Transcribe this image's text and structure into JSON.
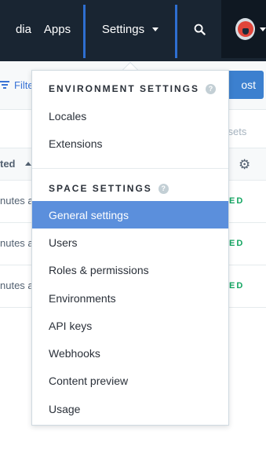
{
  "topnav": {
    "media_label": "dia",
    "apps_label": "Apps",
    "settings_label": "Settings",
    "search_icon": "search-icon",
    "account_icon": "avatar"
  },
  "toolbar": {
    "filter_label": "Filte",
    "add_button_label": "ost"
  },
  "assets_link": "ssets",
  "table": {
    "updated_header": "ted",
    "rows": [
      {
        "time": "nutes ag",
        "status": "ED"
      },
      {
        "time": "nutes a",
        "status": "ED"
      },
      {
        "time": "nutes a",
        "status": "ED"
      }
    ]
  },
  "dropdown": {
    "environment_heading": "ENVIRONMENT SETTINGS",
    "environment_items": [
      "Locales",
      "Extensions"
    ],
    "space_heading": "SPACE SETTINGS",
    "space_items": [
      "General settings",
      "Users",
      "Roles & permissions",
      "Environments",
      "API keys",
      "Webhooks",
      "Content preview",
      "Usage"
    ],
    "active_item": "General settings"
  },
  "colors": {
    "nav_background": "#192532",
    "nav_accent": "#2e6fd1",
    "active_item": "#5b8fdc",
    "published_status": "#14a662"
  }
}
